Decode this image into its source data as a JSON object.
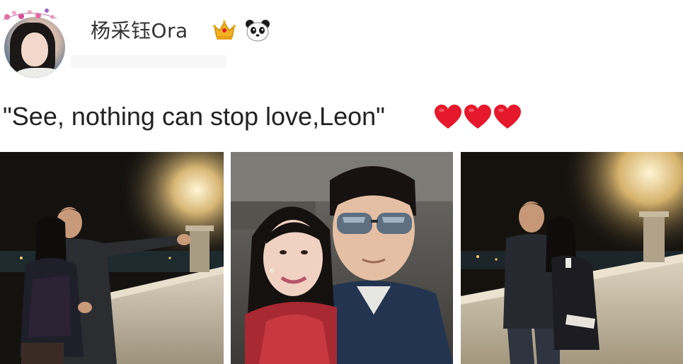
{
  "post": {
    "username": "杨采钰Ora",
    "caption": "\"See, nothing can stop love,Leon\"",
    "badges": [
      "crown-badge-icon",
      "panda-icon"
    ],
    "reaction_icons": [
      "heart-icon",
      "heart-icon",
      "heart-icon"
    ],
    "photos": [
      {
        "name": "night-selfie-terrace"
      },
      {
        "name": "couple-selfie-closeup"
      },
      {
        "name": "night-terrace-phone"
      }
    ]
  },
  "colors": {
    "heart": "#e5192b",
    "crown": "#f2b221",
    "text": "#222222"
  }
}
